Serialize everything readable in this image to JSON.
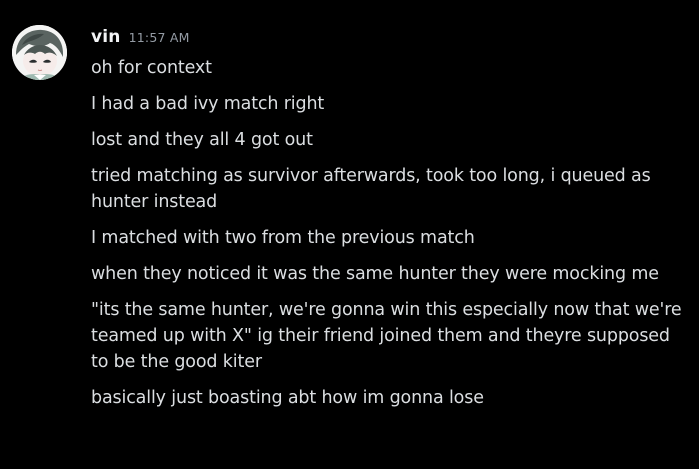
{
  "author": {
    "username": "vin",
    "timestamp": "11:57 AM",
    "avatar_icon": "anime-avatar-icon"
  },
  "colors": {
    "background": "#000000",
    "username": "#f2f3f5",
    "timestamp": "#949ba4",
    "message_text": "#dbdee1"
  },
  "messages": [
    "oh for context",
    "I had a bad ivy match right",
    "lost and they all 4 got out",
    "tried matching as survivor afterwards, took too long, i queued as hunter instead",
    "I matched with two from the previous match",
    "when they noticed it was the same hunter they were mocking me",
    "\"its the same hunter, we're gonna win this especially now that we're teamed up with X\" ig their friend joined them and theyre supposed to be the good kiter",
    "basically just boasting abt how im gonna lose"
  ]
}
